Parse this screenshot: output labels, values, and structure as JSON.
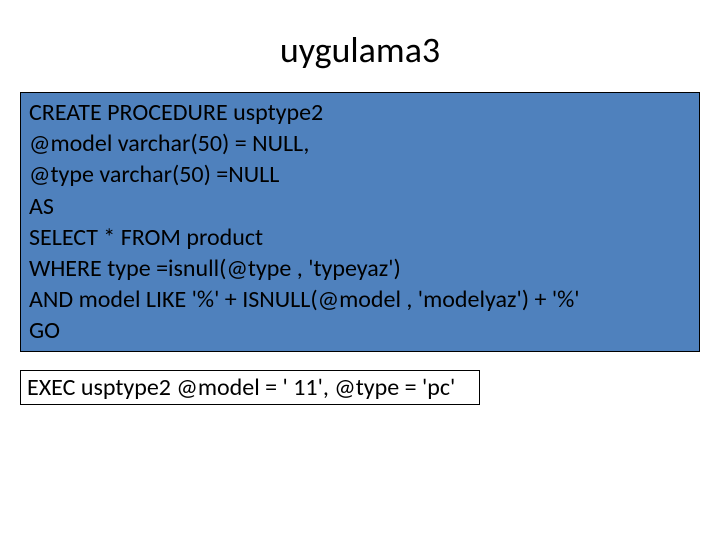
{
  "title": "uygulama3",
  "code": {
    "line1": "CREATE PROCEDURE usptype2",
    "line2": "@model varchar(50) = NULL,",
    "line3": "@type varchar(50) =NULL",
    "line4": "AS",
    "line5": "SELECT *  FROM product",
    "line6": "WHERE type =isnull(@type , 'typeyaz')",
    "line7": "AND model LIKE '%' + ISNULL(@model , 'modelyaz') + '%'",
    "line8": "GO"
  },
  "exec": "EXEC usptype2 @model = ' 11', @type = 'pc'"
}
